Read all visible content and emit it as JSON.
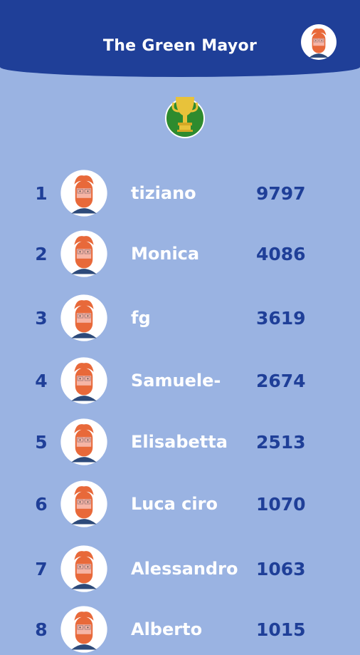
{
  "header": {
    "title": "The Green Mayor",
    "avatar_icon": "user-avatar-icon"
  },
  "trophy_icon": "trophy-icon",
  "colors": {
    "header_bg": "#1f3f98",
    "page_bg": "#9ab3e2",
    "rank_score": "#1f3f98",
    "name_text": "#ffffff",
    "avatar_hair": "#e8693a",
    "trophy_badge": "#2e8b2e",
    "trophy_gold": "#e8c23a"
  },
  "leaderboard": [
    {
      "rank": "1",
      "name": "tiziano",
      "score": "9797"
    },
    {
      "rank": "2",
      "name": "Monica",
      "score": "4086"
    },
    {
      "rank": "3",
      "name": "fg",
      "score": "3619"
    },
    {
      "rank": "4",
      "name": "Samuele-",
      "score": "2674"
    },
    {
      "rank": "5",
      "name": "Elisabetta",
      "score": "2513"
    },
    {
      "rank": "6",
      "name": "Luca ciro",
      "score": "1070"
    },
    {
      "rank": "7",
      "name": "Alessandro",
      "score": "1063"
    },
    {
      "rank": "8",
      "name": "Alberto",
      "score": "1015"
    }
  ]
}
